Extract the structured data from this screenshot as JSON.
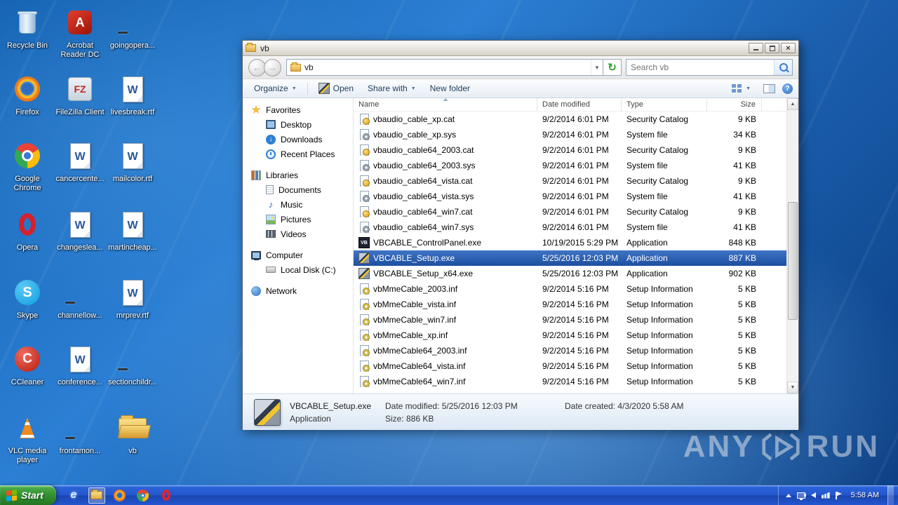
{
  "colors": {
    "selection_blue": "#1d4fa0",
    "taskbar_blue": "#2457cc",
    "start_green": "#2f8f2e",
    "desktop_blue": "#1b5fae"
  },
  "desktop": {
    "icons": [
      {
        "label": "Recycle Bin",
        "icon": "recycle-bin-icon"
      },
      {
        "label": "Firefox",
        "icon": "firefox-icon"
      },
      {
        "label": "Google Chrome",
        "icon": "chrome-icon"
      },
      {
        "label": "Opera",
        "icon": "opera-icon"
      },
      {
        "label": "Skype",
        "icon": "skype-icon"
      },
      {
        "label": "CCleaner",
        "icon": "ccleaner-icon"
      },
      {
        "label": "VLC media player",
        "icon": "vlc-icon"
      },
      {
        "label": "Acrobat Reader DC",
        "icon": "acrobat-icon"
      },
      {
        "label": "FileZilla Client",
        "icon": "filezilla-icon"
      },
      {
        "label": "cancercente...",
        "icon": "word-doc-icon"
      },
      {
        "label": "changeslea...",
        "icon": "word-doc-icon"
      },
      {
        "label": "channellow...",
        "icon": "blank-shortcut-icon"
      },
      {
        "label": "conference...",
        "icon": "word-doc-icon"
      },
      {
        "label": "frontamon...",
        "icon": "blank-shortcut-icon"
      },
      {
        "label": "goingopera...",
        "icon": "blank-shortcut-icon"
      },
      {
        "label": "livesbreak.rtf",
        "icon": "word-doc-icon"
      },
      {
        "label": "mailcolor.rtf",
        "icon": "word-doc-icon"
      },
      {
        "label": "martincheap...",
        "icon": "word-doc-icon"
      },
      {
        "label": "mrprev.rtf",
        "icon": "word-doc-icon"
      },
      {
        "label": "sectionchildr...",
        "icon": "blank-shortcut-icon"
      },
      {
        "label": "vb",
        "icon": "folder-icon"
      }
    ]
  },
  "window": {
    "title": "vb",
    "nav": {
      "address_location": "vb",
      "search_placeholder": "Search vb"
    },
    "toolbar": {
      "organize": "Organize",
      "open": "Open",
      "share_with": "Share with",
      "new_folder": "New folder"
    },
    "sidebar": {
      "favorites_label": "Favorites",
      "favorites": [
        "Desktop",
        "Downloads",
        "Recent Places"
      ],
      "libraries_label": "Libraries",
      "libraries": [
        "Documents",
        "Music",
        "Pictures",
        "Videos"
      ],
      "computer_label": "Computer",
      "computer": [
        "Local Disk (C:)"
      ],
      "network_label": "Network"
    },
    "columns": [
      "Name",
      "Date modified",
      "Type",
      "Size"
    ],
    "files": [
      {
        "icon": "security-catalog",
        "name": "vbaudio_cable_xp.cat",
        "modified": "9/2/2014 6:01 PM",
        "type": "Security Catalog",
        "size": "9 KB"
      },
      {
        "icon": "system-file",
        "name": "vbaudio_cable_xp.sys",
        "modified": "9/2/2014 6:01 PM",
        "type": "System file",
        "size": "34 KB"
      },
      {
        "icon": "security-catalog",
        "name": "vbaudio_cable64_2003.cat",
        "modified": "9/2/2014 6:01 PM",
        "type": "Security Catalog",
        "size": "9 KB"
      },
      {
        "icon": "system-file",
        "name": "vbaudio_cable64_2003.sys",
        "modified": "9/2/2014 6:01 PM",
        "type": "System file",
        "size": "41 KB"
      },
      {
        "icon": "security-catalog",
        "name": "vbaudio_cable64_vista.cat",
        "modified": "9/2/2014 6:01 PM",
        "type": "Security Catalog",
        "size": "9 KB"
      },
      {
        "icon": "system-file",
        "name": "vbaudio_cable64_vista.sys",
        "modified": "9/2/2014 6:01 PM",
        "type": "System file",
        "size": "41 KB"
      },
      {
        "icon": "security-catalog",
        "name": "vbaudio_cable64_win7.cat",
        "modified": "9/2/2014 6:01 PM",
        "type": "Security Catalog",
        "size": "9 KB"
      },
      {
        "icon": "system-file",
        "name": "vbaudio_cable64_win7.sys",
        "modified": "9/2/2014 6:01 PM",
        "type": "System file",
        "size": "41 KB"
      },
      {
        "icon": "vb-application",
        "name": "VBCABLE_ControlPanel.exe",
        "modified": "10/19/2015 5:29 PM",
        "type": "Application",
        "size": "848 KB"
      },
      {
        "icon": "setup-application",
        "name": "VBCABLE_Setup.exe",
        "modified": "5/25/2016 12:03 PM",
        "type": "Application",
        "size": "887 KB",
        "selected": true
      },
      {
        "icon": "setup-application",
        "name": "VBCABLE_Setup_x64.exe",
        "modified": "5/25/2016 12:03 PM",
        "type": "Application",
        "size": "902 KB"
      },
      {
        "icon": "setup-information",
        "name": "vbMmeCable_2003.inf",
        "modified": "9/2/2014 5:16 PM",
        "type": "Setup Information",
        "size": "5 KB"
      },
      {
        "icon": "setup-information",
        "name": "vbMmeCable_vista.inf",
        "modified": "9/2/2014 5:16 PM",
        "type": "Setup Information",
        "size": "5 KB"
      },
      {
        "icon": "setup-information",
        "name": "vbMmeCable_win7.inf",
        "modified": "9/2/2014 5:16 PM",
        "type": "Setup Information",
        "size": "5 KB"
      },
      {
        "icon": "setup-information",
        "name": "vbMmeCable_xp.inf",
        "modified": "9/2/2014 5:16 PM",
        "type": "Setup Information",
        "size": "5 KB"
      },
      {
        "icon": "setup-information",
        "name": "vbMmeCable64_2003.inf",
        "modified": "9/2/2014 5:16 PM",
        "type": "Setup Information",
        "size": "5 KB"
      },
      {
        "icon": "setup-information",
        "name": "vbMmeCable64_vista.inf",
        "modified": "9/2/2014 5:16 PM",
        "type": "Setup Information",
        "size": "5 KB"
      },
      {
        "icon": "setup-information",
        "name": "vbMmeCable64_win7.inf",
        "modified": "9/2/2014 5:16 PM",
        "type": "Setup Information",
        "size": "5 KB"
      }
    ],
    "details": {
      "name": "VBCABLE_Setup.exe",
      "modified_label": "Date modified:",
      "modified_value": "5/25/2016 12:03 PM",
      "created_label": "Date created:",
      "created_value": "4/3/2020 5:58 AM",
      "type": "Application",
      "size_label": "Size:",
      "size_value": "886 KB"
    }
  },
  "taskbar": {
    "start_label": "Start",
    "clock": "5:58 AM",
    "quick_launch": [
      "internet-explorer",
      "windows-explorer",
      "firefox",
      "chrome",
      "opera"
    ],
    "tray_icons": [
      "hidden-icons",
      "display",
      "volume",
      "network",
      "action-center"
    ]
  },
  "watermark": {
    "left": "ANY",
    "right": "RUN"
  }
}
